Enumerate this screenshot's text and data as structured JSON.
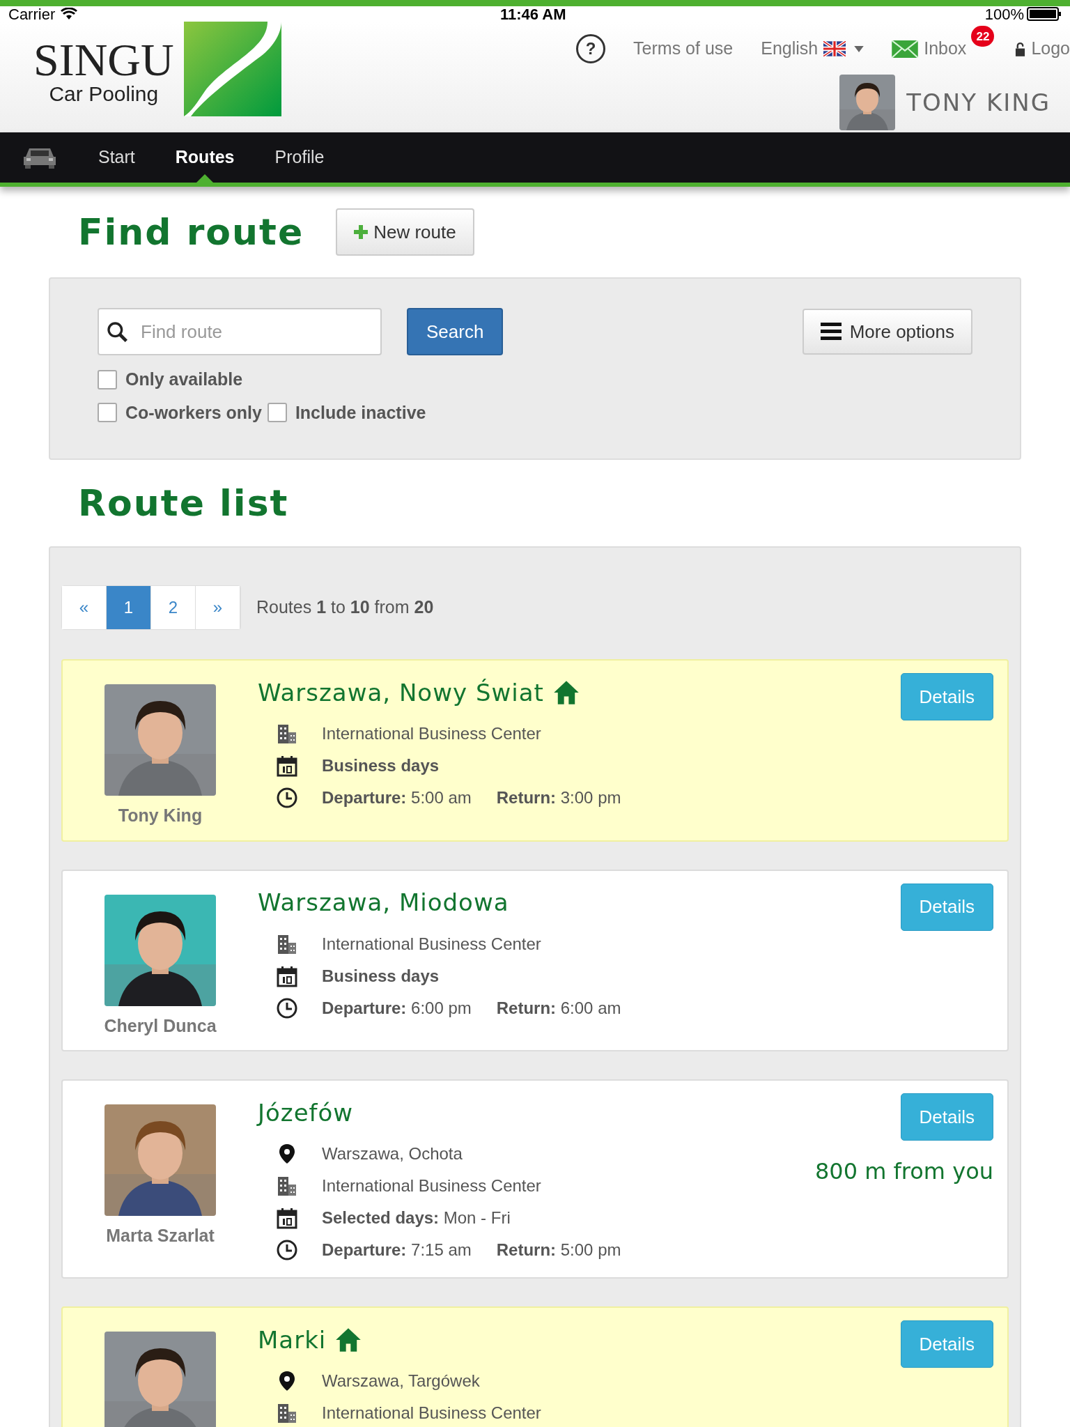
{
  "status_bar": {
    "carrier": "Carrier",
    "time": "11:46 AM",
    "battery": "100%"
  },
  "header": {
    "logo_title": "SINGU",
    "logo_subtitle": "Car Pooling",
    "links": [
      {
        "kind": "help",
        "label": "?"
      },
      {
        "kind": "link",
        "label": "Terms of use"
      },
      {
        "kind": "language",
        "label": "English"
      },
      {
        "kind": "inbox",
        "label": "Inbox",
        "badge": "22"
      },
      {
        "kind": "logout",
        "label": "Logo"
      }
    ],
    "user_name": "TONY KING"
  },
  "nav": {
    "items": [
      {
        "label": "Start",
        "selected": false
      },
      {
        "label": "Routes",
        "selected": true
      },
      {
        "label": "Profile",
        "selected": false
      }
    ]
  },
  "find": {
    "title": "Find route",
    "new_button": "New route",
    "search": {
      "placeholder": "Find route"
    },
    "search_button": "Search",
    "more_button": "More options",
    "checkboxes": [
      [
        {
          "label": "Only available",
          "checked": false
        }
      ],
      [
        {
          "label": "Co-workers only",
          "checked": false
        },
        {
          "label": "Include inactive",
          "checked": false
        }
      ]
    ]
  },
  "list": {
    "title": "Route list",
    "pagination": [
      {
        "label": "«",
        "selected": false
      },
      {
        "label": "1",
        "selected": true
      },
      {
        "label": "2",
        "selected": false
      },
      {
        "label": "»",
        "selected": false
      }
    ],
    "summary": "Routes **1** to **10** from **20**",
    "routes": [
      {
        "name": "Tony King",
        "title": "Warszawa, Nowy Świat",
        "home": true,
        "highlighted": true,
        "details": "Details",
        "lines": [
          {
            "kind": "building",
            "text": "International Business Center"
          },
          {
            "kind": "days",
            "label": "Business days"
          },
          {
            "kind": "times",
            "departure_label": "Departure:",
            "departure": "5:00 am",
            "return_label": "Return:",
            "return": "3:00 pm"
          }
        ]
      },
      {
        "name": "Cheryl Dunca",
        "title": "Warszawa, Miodowa",
        "home": false,
        "highlighted": false,
        "details": "Details",
        "lines": [
          {
            "kind": "building",
            "text": "International Business Center"
          },
          {
            "kind": "days",
            "label": "Business days"
          },
          {
            "kind": "times",
            "departure_label": "Departure:",
            "departure": "6:00 pm",
            "return_label": "Return:",
            "return": "6:00 am"
          }
        ]
      },
      {
        "name": "Marta Szarlat",
        "title": "Józefów",
        "home": false,
        "highlighted": false,
        "details": "Details",
        "distance": "800 m from you",
        "lines": [
          {
            "kind": "pin",
            "text": "Warszawa, Ochota"
          },
          {
            "kind": "building",
            "text": "International Business Center"
          },
          {
            "kind": "days",
            "label": "Selected days:",
            "value": "Mon - Fri"
          },
          {
            "kind": "times",
            "departure_label": "Departure:",
            "departure": "7:15 am",
            "return_label": "Return:",
            "return": "5:00 pm"
          }
        ]
      },
      {
        "title": "Marki",
        "home": true,
        "highlighted": true,
        "details": "Details",
        "lines": [
          {
            "kind": "pin",
            "text": "Warszawa, Targówek"
          },
          {
            "kind": "building",
            "text": "International Business Center"
          }
        ]
      }
    ]
  }
}
